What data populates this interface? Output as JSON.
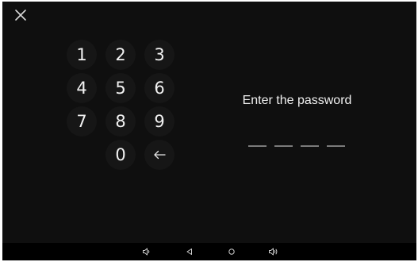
{
  "header": {
    "close_icon": "close-icon"
  },
  "keypad": {
    "keys": [
      "1",
      "2",
      "3",
      "4",
      "5",
      "6",
      "7",
      "8",
      "9",
      "0"
    ],
    "backspace_icon": "backspace-arrow-icon"
  },
  "password": {
    "prompt": "Enter the password",
    "length": 4
  },
  "navbar": {
    "icons": [
      "volume-down-icon",
      "back-icon",
      "home-icon",
      "volume-up-icon"
    ]
  },
  "colors": {
    "background": "#0f0f0f",
    "key_background": "#161616",
    "text": "#f0f0f0",
    "slot": "#7a7a7a",
    "navbar": "#000000"
  }
}
